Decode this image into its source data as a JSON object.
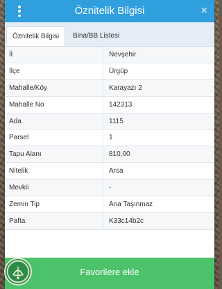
{
  "header": {
    "title": "Öznitelik Bilgisi",
    "close_symbol": "×"
  },
  "tabs": [
    {
      "label": "Öznitelik Bilgisi",
      "active": true
    },
    {
      "label": "Bina/BB Listesi",
      "active": false
    }
  ],
  "rows": [
    {
      "label": "İl",
      "value": "Nevşehir"
    },
    {
      "label": "İlçe",
      "value": "Ürgüp"
    },
    {
      "label": "Mahalle/Köy",
      "value": "Karayazı 2"
    },
    {
      "label": "Mahalle No",
      "value": "142313"
    },
    {
      "label": "Ada",
      "value": "1115"
    },
    {
      "label": "Parsel",
      "value": "1"
    },
    {
      "label": "Tapu Alanı",
      "value": "810,00"
    },
    {
      "label": "Nitelik",
      "value": "Arsa"
    },
    {
      "label": "Mevkii",
      "value": "-"
    },
    {
      "label": "Zemin Tip",
      "value": "Ana Taşınmaz"
    },
    {
      "label": "Pafta",
      "value": "K33c14b2c"
    }
  ],
  "favorite_button": {
    "label": "Favorilere ekle"
  },
  "colors": {
    "header": "#2f9fde",
    "favorite_button": "#4cc26b",
    "logo": "#2e8b47"
  },
  "icons": [
    "more-vertical-icon",
    "close-icon",
    "tkgm-logo-icon"
  ]
}
